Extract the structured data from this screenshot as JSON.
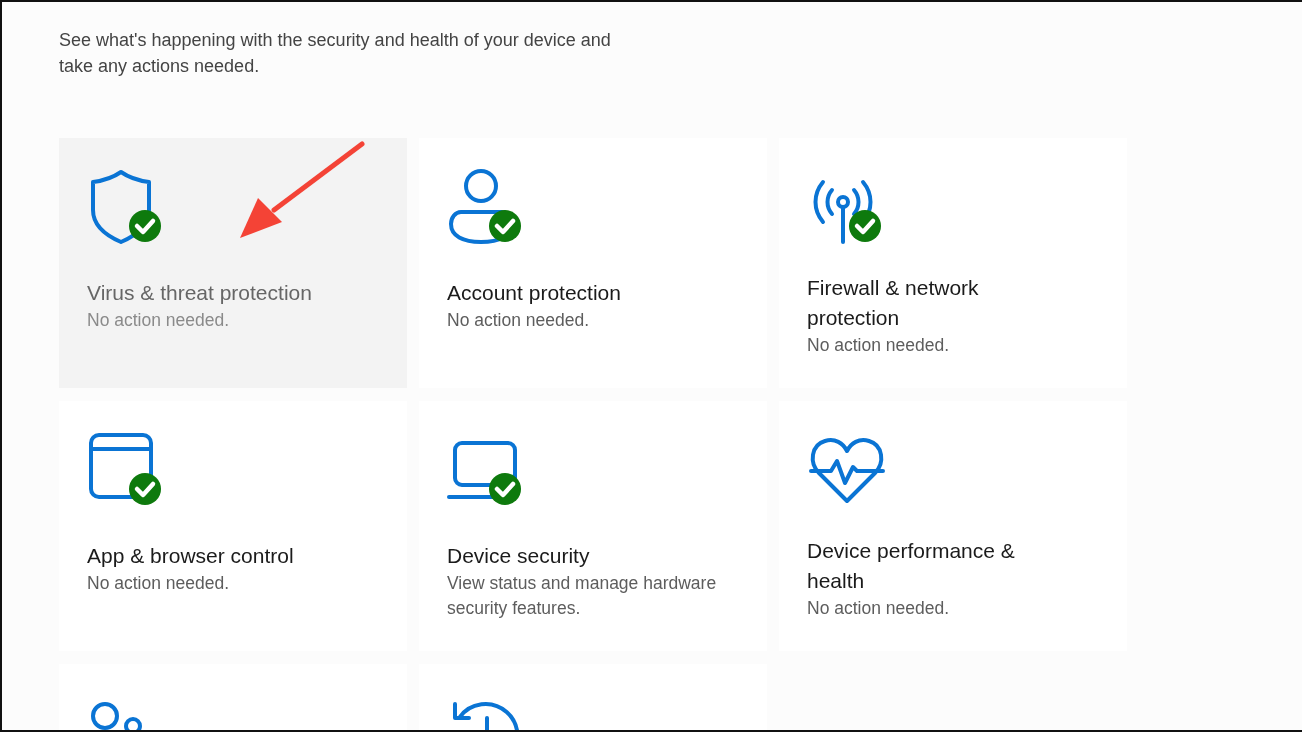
{
  "description": "See what's happening with the security and health of your device and take any actions needed.",
  "cards": [
    {
      "kind": "shield",
      "title": "Virus & threat protection",
      "status": "No action needed.",
      "ok": true,
      "hovered": true
    },
    {
      "kind": "person",
      "title": "Account protection",
      "status": "No action needed.",
      "ok": true,
      "hovered": false
    },
    {
      "kind": "antenna",
      "title": "Firewall & network protection",
      "status": "No action needed.",
      "ok": true,
      "hovered": false
    },
    {
      "kind": "window",
      "title": "App & browser control",
      "status": "No action needed.",
      "ok": true,
      "hovered": false
    },
    {
      "kind": "laptop",
      "title": "Device security",
      "status": "View status and manage hardware security features.",
      "ok": true,
      "hovered": false
    },
    {
      "kind": "heart",
      "title": "Device performance & health",
      "status": "No action needed.",
      "ok": false,
      "hovered": false
    },
    {
      "kind": "people",
      "hovered": false
    },
    {
      "kind": "history",
      "hovered": false
    }
  ]
}
